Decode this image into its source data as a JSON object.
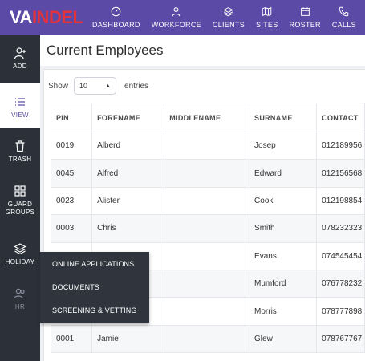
{
  "header": {
    "logo": {
      "part_a": "VA",
      "part_b": "INDEL",
      "mark_color": "#e2323e"
    },
    "nav": [
      {
        "label": "DASHBOARD",
        "icon": "dashboard-gauge-icon"
      },
      {
        "label": "WORKFORCE",
        "icon": "user-icon"
      },
      {
        "label": "CLIENTS",
        "icon": "layers-icon"
      },
      {
        "label": "SITES",
        "icon": "map-icon"
      },
      {
        "label": "ROSTER",
        "icon": "calendar-icon"
      },
      {
        "label": "CALLS",
        "icon": "phone-icon"
      }
    ],
    "accent": "#5b4aa6"
  },
  "sidebar": {
    "items": [
      {
        "label": "ADD",
        "icon": "add-user-icon"
      },
      {
        "label": "VIEW",
        "icon": "list-icon",
        "active": true
      },
      {
        "label": "TRASH",
        "icon": "trash-icon"
      },
      {
        "label": "GUARD GROUPS",
        "icon": "grid-icon"
      },
      {
        "label": "HOLIDAY",
        "icon": "layers-icon"
      },
      {
        "label": "HR",
        "icon": "users-icon"
      }
    ]
  },
  "main": {
    "title": "Current Employees",
    "show_label": "Show",
    "entries_value": "10",
    "entries_label": "entries",
    "columns": [
      "PIN",
      "FORENAME",
      "MIDDLENAME",
      "SURNAME",
      "CONTACT"
    ],
    "rows": [
      {
        "pin": "0019",
        "forename": "Alberd",
        "middlename": "",
        "surname": "Josep",
        "contact": "012189956"
      },
      {
        "pin": "0045",
        "forename": "Alfred",
        "middlename": "",
        "surname": "Edward",
        "contact": "012156568"
      },
      {
        "pin": "0023",
        "forename": "Alister",
        "middlename": "",
        "surname": "Cook",
        "contact": "012198854"
      },
      {
        "pin": "0003",
        "forename": "Chris",
        "middlename": "",
        "surname": "Smith",
        "contact": "078232323"
      },
      {
        "pin": "",
        "forename": "",
        "middlename": "",
        "surname": "Evans",
        "contact": "074545454"
      },
      {
        "pin": "",
        "forename": "",
        "middlename": "",
        "surname": "Mumford",
        "contact": "076778232"
      },
      {
        "pin": "",
        "forename": "",
        "middlename": "",
        "surname": "Morris",
        "contact": "078777898"
      },
      {
        "pin": "0001",
        "forename": "Jamie",
        "middlename": "",
        "surname": "Glew",
        "contact": "078767767"
      }
    ]
  },
  "hr_menu": {
    "items": [
      "ONLINE APPLICATIONS",
      "DOCUMENTS",
      "SCREENING & VETTING"
    ]
  }
}
